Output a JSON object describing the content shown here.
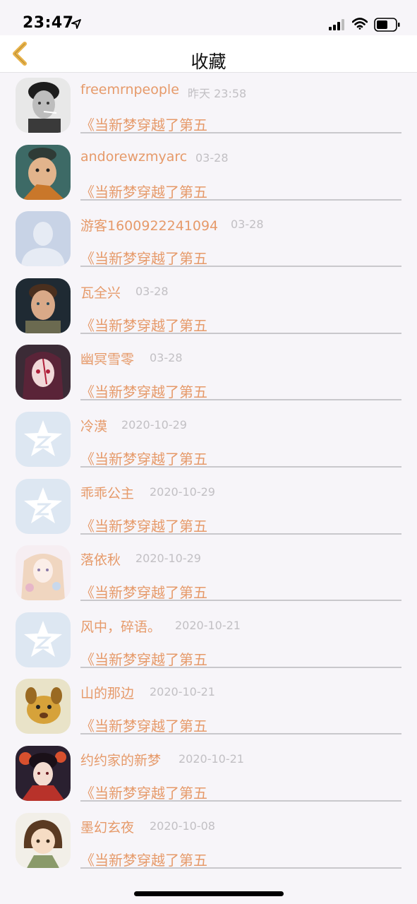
{
  "status_bar": {
    "time": "23:47"
  },
  "nav": {
    "title": "收藏"
  },
  "colors": {
    "accent": "#e69a6a",
    "time": "#c2c0c4",
    "back": "#e8b24a"
  },
  "items": [
    {
      "name": "freemrnpeople",
      "time": "昨天 23:58",
      "book": "《当新梦穿越了第五",
      "avatar": "photo-bw-icon"
    },
    {
      "name": "andorewzmyarc",
      "time": "03-28",
      "book": "《当新梦穿越了第五",
      "avatar": "character-hat-icon"
    },
    {
      "name": "游客1600922241094",
      "time": "03-28",
      "book": "《当新梦穿越了第五",
      "avatar": "default-person-icon"
    },
    {
      "name": "瓦全兴",
      "time": "03-28",
      "book": "《当新梦穿越了第五",
      "avatar": "boy-portrait-icon"
    },
    {
      "name": "幽冥雪零",
      "time": "03-28",
      "book": "《当新梦穿越了第五",
      "avatar": "anime-girl-icon"
    },
    {
      "name": "冷漠",
      "time": "2020-10-29",
      "book": "《当新梦穿越了第五",
      "avatar": "qq-star-icon"
    },
    {
      "name": "乖乖公主",
      "time": "2020-10-29",
      "book": "《当新梦穿越了第五",
      "avatar": "qq-star-icon"
    },
    {
      "name": "落依秋",
      "time": "2020-10-29",
      "book": "《当新梦穿越了第五",
      "avatar": "pastel-anime-icon"
    },
    {
      "name": "风中，碎语。",
      "time": "2020-10-21",
      "book": "《当新梦穿越了第五",
      "avatar": "qq-star-icon"
    },
    {
      "name": "山的那边",
      "time": "2020-10-21",
      "book": "《当新梦穿越了第五",
      "avatar": "cartoon-dog-icon"
    },
    {
      "name": "约约家的新梦",
      "time": "2020-10-21",
      "book": "《当新梦穿越了第五",
      "avatar": "geisha-anime-icon"
    },
    {
      "name": "墨幻玄夜",
      "time": "2020-10-08",
      "book": "《当新梦穿越了第五",
      "avatar": "chibi-boy-icon"
    }
  ]
}
